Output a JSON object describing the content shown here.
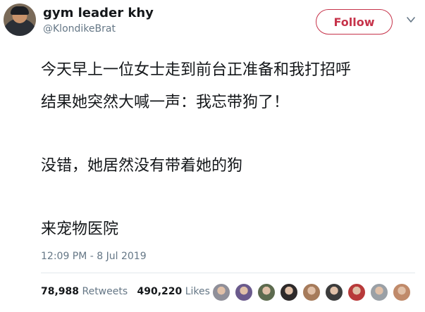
{
  "user": {
    "display_name": "gym leader khy",
    "handle": "@KlondikeBrat"
  },
  "header": {
    "follow_label": "Follow"
  },
  "tweet": {
    "lines": [
      "今天早上一位女士走到前台正准备和我打招呼",
      "结果她突然大喊一声：我忘带狗了！",
      "没错，她居然没有带着她的狗",
      "来宠物医院"
    ],
    "timestamp": "12:09 PM - 8 Jul 2019"
  },
  "stats": {
    "retweets_count": "78,988",
    "retweets_label": "Retweets",
    "likes_count": "490,220",
    "likes_label": "Likes"
  },
  "colors": {
    "accent": "#c6334a",
    "muted_text": "#657786",
    "divider": "#e1e8ed"
  },
  "likers": [
    {
      "icon": "liker-avatar-1",
      "color": "#8f8f99"
    },
    {
      "icon": "liker-avatar-2",
      "color": "#6a5a8c"
    },
    {
      "icon": "liker-avatar-3",
      "color": "#5d6b4f"
    },
    {
      "icon": "liker-avatar-4",
      "color": "#2e2a2a"
    },
    {
      "icon": "liker-avatar-5",
      "color": "#a67b5b"
    },
    {
      "icon": "liker-avatar-6",
      "color": "#3c3c3c"
    },
    {
      "icon": "liker-avatar-7",
      "color": "#b83a3a"
    },
    {
      "icon": "liker-avatar-8",
      "color": "#9aa0a6"
    },
    {
      "icon": "liker-avatar-9",
      "color": "#c08a6a"
    }
  ]
}
